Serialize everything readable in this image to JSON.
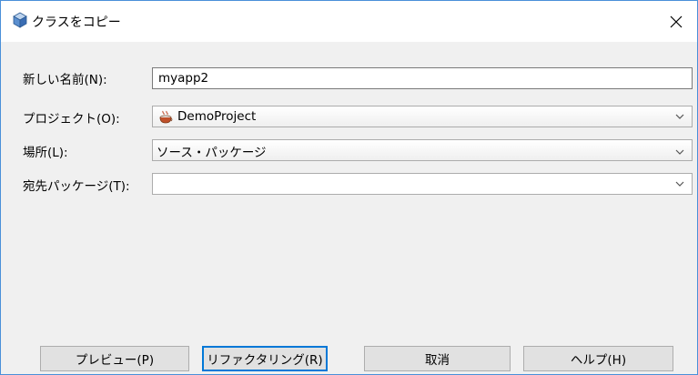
{
  "dialog": {
    "title": "クラスをコピー",
    "icon": "class-cube-icon"
  },
  "form": {
    "new_name": {
      "label": "新しい名前(N):",
      "value": "myapp2"
    },
    "project": {
      "label": "プロジェクト(O):",
      "value": "DemoProject",
      "icon": "coffee-cup-icon"
    },
    "location": {
      "label": "場所(L):",
      "value": "ソース・パッケージ"
    },
    "target_package": {
      "label": "宛先パッケージ(T):",
      "value": ""
    }
  },
  "buttons": {
    "preview": "プレビュー(P)",
    "refactor": "リファクタリング(R)",
    "cancel": "取消",
    "help": "ヘルプ(H)"
  },
  "colors": {
    "accent": "#0078d7",
    "window_border": "#4a90d9",
    "dialog_bg": "#f0f0f0"
  }
}
